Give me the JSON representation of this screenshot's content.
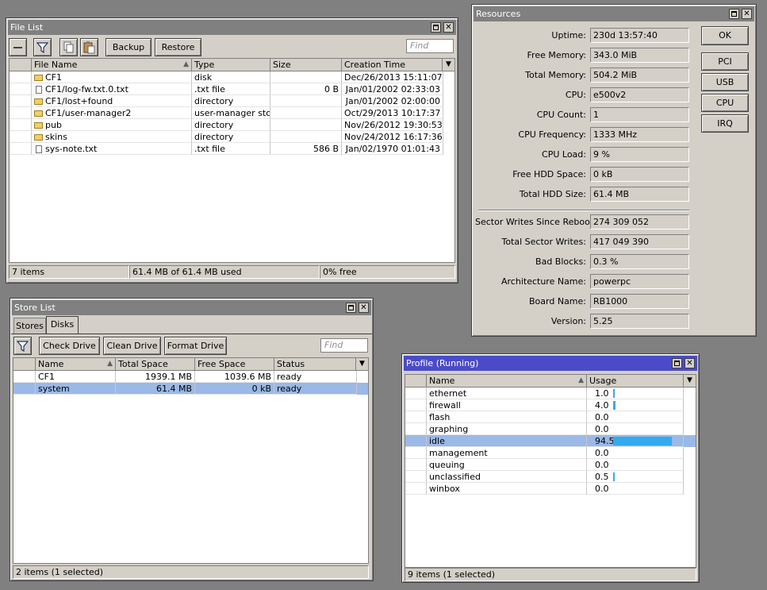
{
  "file_list": {
    "title": "File List",
    "buttons": {
      "backup": "Backup",
      "restore": "Restore"
    },
    "find_placeholder": "Find",
    "columns": [
      "File Name",
      "Type",
      "Size",
      "Creation Time"
    ],
    "rows": [
      {
        "name": "CF1",
        "type": "disk",
        "size": "",
        "time": "Dec/26/2013 15:11:07",
        "icon": "folder-icon"
      },
      {
        "name": "CF1/log-fw.txt.0.txt",
        "type": ".txt file",
        "size": "0 B",
        "time": "Jan/01/2002 02:33:03",
        "icon": "file-icon"
      },
      {
        "name": "CF1/lost+found",
        "type": "directory",
        "size": "",
        "time": "Jan/01/2002 02:00:00",
        "icon": "folder-icon"
      },
      {
        "name": "CF1/user-manager2",
        "type": "user-manager store",
        "size": "",
        "time": "Oct/29/2013 10:17:37",
        "icon": "folder-icon"
      },
      {
        "name": "pub",
        "type": "directory",
        "size": "",
        "time": "Nov/26/2012 19:30:53",
        "icon": "folder-icon"
      },
      {
        "name": "skins",
        "type": "directory",
        "size": "",
        "time": "Nov/24/2012 16:17:36",
        "icon": "folder-icon"
      },
      {
        "name": "sys-note.txt",
        "type": ".txt file",
        "size": "586 B",
        "time": "Jan/02/1970 01:01:43",
        "icon": "file-icon"
      }
    ],
    "status": {
      "items": "7 items",
      "used": "61.4 MB of 61.4 MB used",
      "free": "0% free"
    }
  },
  "resources": {
    "title": "Resources",
    "fields": [
      {
        "label": "Uptime:",
        "value": "230d 13:57:40"
      },
      {
        "label": "Free Memory:",
        "value": "343.0 MiB"
      },
      {
        "label": "Total Memory:",
        "value": "504.2 MiB"
      },
      {
        "label": "CPU:",
        "value": "e500v2"
      },
      {
        "label": "CPU Count:",
        "value": "1"
      },
      {
        "label": "CPU Frequency:",
        "value": "1333 MHz"
      },
      {
        "label": "CPU Load:",
        "value": "9 %"
      },
      {
        "label": "Free HDD Space:",
        "value": "0 kB"
      },
      {
        "label": "Total HDD Size:",
        "value": "61.4 MB"
      },
      {
        "label": "Sector Writes Since Reboot:",
        "value": "274 309 052"
      },
      {
        "label": "Total Sector Writes:",
        "value": "417 049 390"
      },
      {
        "label": "Bad Blocks:",
        "value": "0.3 %"
      },
      {
        "label": "Architecture Name:",
        "value": "powerpc"
      },
      {
        "label": "Board Name:",
        "value": "RB1000"
      },
      {
        "label": "Version:",
        "value": "5.25"
      }
    ],
    "buttons": {
      "ok": "OK",
      "pci": "PCI",
      "usb": "USB",
      "cpu": "CPU",
      "irq": "IRQ"
    }
  },
  "store_list": {
    "title": "Store List",
    "tabs": [
      "Stores",
      "Disks"
    ],
    "buttons": {
      "check": "Check Drive",
      "clean": "Clean Drive",
      "format": "Format Drive"
    },
    "find_placeholder": "Find",
    "columns": [
      "Name",
      "Total Space",
      "Free Space",
      "Status"
    ],
    "rows": [
      {
        "name": "CF1",
        "total": "1939.1 MB",
        "free": "1039.6 MB",
        "status": "ready"
      },
      {
        "name": "system",
        "total": "61.4 MB",
        "free": "0 kB",
        "status": "ready"
      }
    ],
    "status": "2 items (1 selected)"
  },
  "profile": {
    "title": "Profile (Running)",
    "columns": [
      "Name",
      "Usage"
    ],
    "rows": [
      {
        "name": "ethernet",
        "usage": "1.0",
        "pct": 1.0
      },
      {
        "name": "firewall",
        "usage": "4.0",
        "pct": 4.0
      },
      {
        "name": "flash",
        "usage": "0.0",
        "pct": 0
      },
      {
        "name": "graphing",
        "usage": "0.0",
        "pct": 0
      },
      {
        "name": "idle",
        "usage": "94.5",
        "pct": 94.5
      },
      {
        "name": "management",
        "usage": "0.0",
        "pct": 0
      },
      {
        "name": "queuing",
        "usage": "0.0",
        "pct": 0
      },
      {
        "name": "unclassified",
        "usage": "0.5",
        "pct": 0.5
      },
      {
        "name": "winbox",
        "usage": "0.0",
        "pct": 0
      }
    ],
    "status": "9 items (1 selected)",
    "bar_color": "#33aaee"
  }
}
